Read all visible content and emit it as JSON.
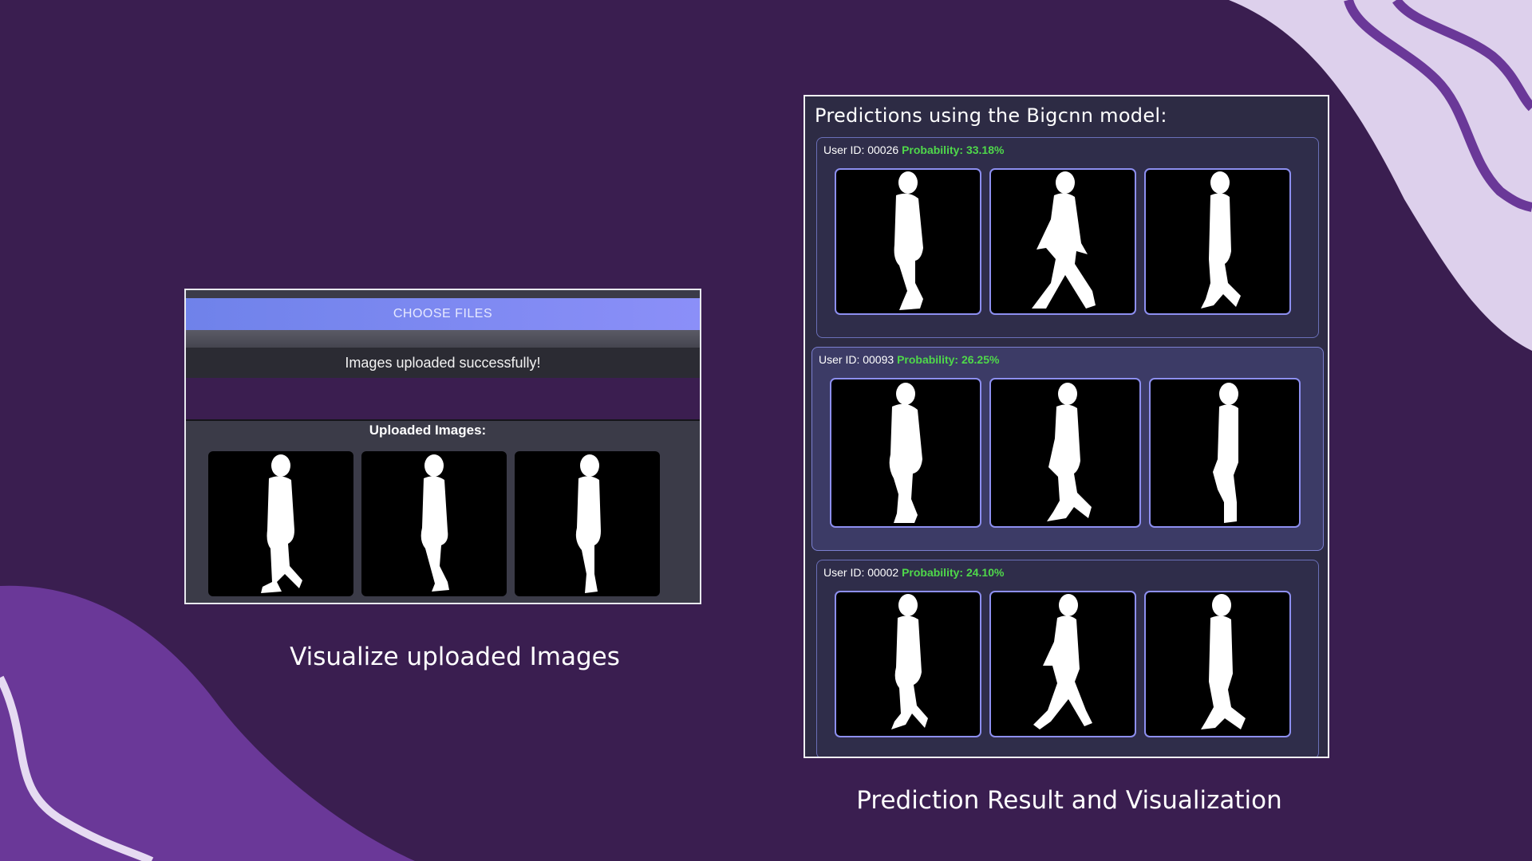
{
  "left": {
    "choose_files": "CHOOSE FILES",
    "success": "Images uploaded successfully!",
    "uploaded_title": "Uploaded Images:",
    "caption": "Visualize uploaded Images",
    "images": [
      "walking-silhouette",
      "walking-silhouette",
      "walking-silhouette"
    ]
  },
  "right": {
    "title": "Predictions using the Bigcnn model:",
    "caption": "Prediction Result and Visualization",
    "predictions": [
      {
        "user": "User ID: 00026",
        "prob": "Probability: 33.18%"
      },
      {
        "user": "User ID: 00093",
        "prob": "Probability: 26.25%"
      },
      {
        "user": "User ID: 00002",
        "prob": "Probability: 24.10%"
      }
    ]
  },
  "colors": {
    "background": "#3a1e50",
    "accent_wave": "#6a3898",
    "light_wave": "#ddd0ec",
    "probability": "#4fd84a",
    "button": "#7b8af0"
  }
}
